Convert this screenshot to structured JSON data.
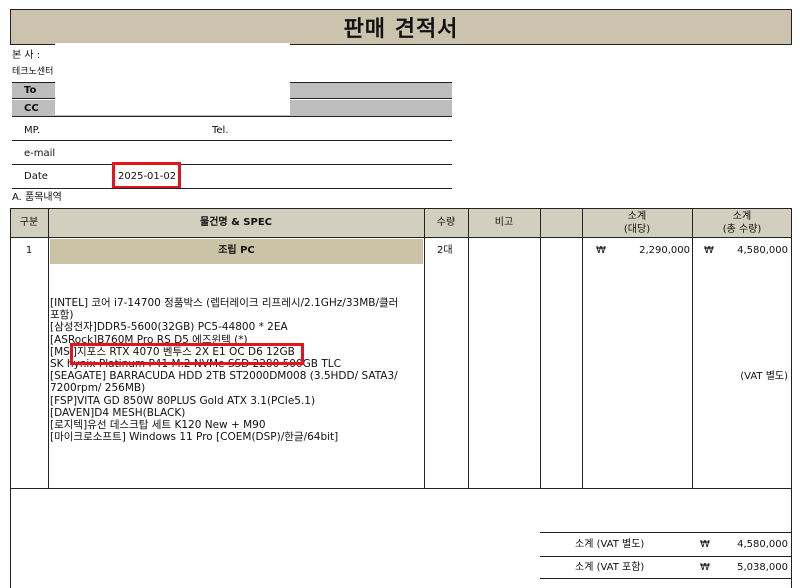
{
  "title": "판매 견적서",
  "header": {
    "company_label": "본    사 :",
    "company_name": "테크노센터",
    "to_label": "To",
    "cc_label": "CC",
    "mp_label": "MP.",
    "tel_label": "Tel.",
    "email_label": "e-mail",
    "date_label": "Date",
    "date_value": "2025-01-02"
  },
  "section_label": "A. 품목내역",
  "columns": {
    "no": "구분",
    "item": "물건명 & SPEC",
    "qty": "수량",
    "note": "비고",
    "subtotal_line1": "소계",
    "subtotal_line2": "(대당)",
    "total_line1": "소계",
    "total_line2": "(총 수량)"
  },
  "row": {
    "no": "1",
    "item_title": "조립 PC",
    "qty": "2대",
    "currency1": "₩",
    "unit_price": "2,290,000",
    "currency2": "₩",
    "total_price": "4,580,000",
    "vat_note": "(VAT 별도)"
  },
  "spec_lines": [
    "[INTEL] 코어 i7-14700 정품박스 (렙터레이크 리프레시/2.1GHz/33MB/클러",
    "포함)",
    "[삼성전자]DDR5-5600(32GB) PC5-44800 * 2EA",
    "[ASRock]B760M Pro RS D5 에즈윈텍 (*)",
    "[MSI]지포스 RTX 4070 벤투스 2X E1 OC D6 12GB",
    "SK hynix Platinum P41 M.2 NVMe SSD 2280 500GB TLC",
    "[SEAGATE] BARRACUDA HDD 2TB ST2000DM008 (3.5HDD/ SATA3/",
    "7200rpm/ 256MB)",
    "[FSP]VITA GD 850W 80PLUS Gold ATX 3.1(PCIe5.1)",
    "[DAVEN]D4 MESH(BLACK)",
    "[로지텍]유선 데스크탑 세트 K120 New + M90",
    "[마이크로소프트] Windows 11 Pro [COEM(DSP)/한글/64bit]"
  ],
  "summary": [
    {
      "label": "소계  (VAT 별도)",
      "currency": "₩",
      "amount": "4,580,000"
    },
    {
      "label": "소계  (VAT 포함)",
      "currency": "₩",
      "amount": "5,038,000"
    }
  ],
  "highlight_color": "#e3141c"
}
